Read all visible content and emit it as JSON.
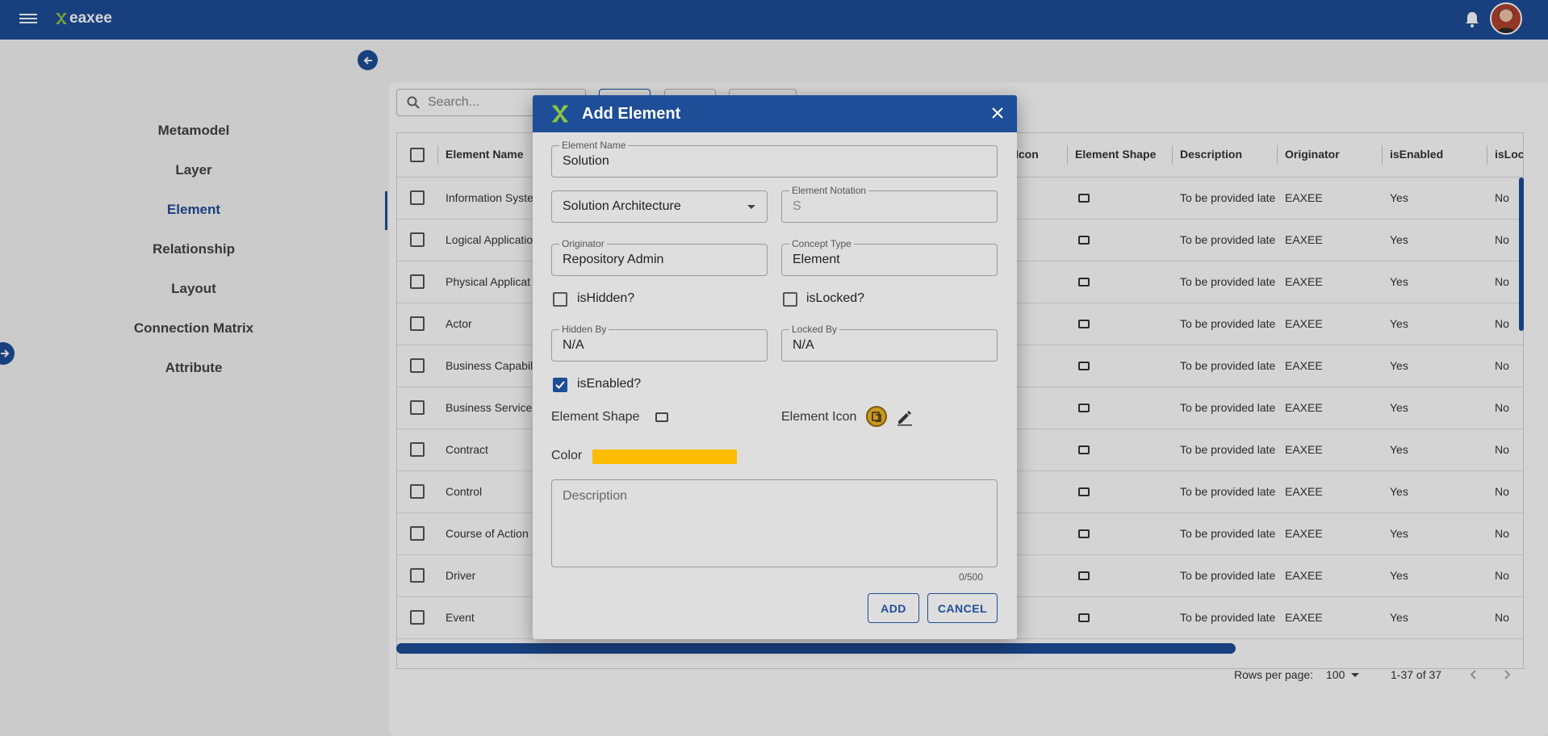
{
  "app": {
    "brand": "eaxee"
  },
  "search": {
    "placeholder": "Search..."
  },
  "sidebar": {
    "items": [
      {
        "label": "Metamodel"
      },
      {
        "label": "Layer"
      },
      {
        "label": "Element"
      },
      {
        "label": "Relationship"
      },
      {
        "label": "Layout"
      },
      {
        "label": "Connection Matrix"
      },
      {
        "label": "Attribute"
      }
    ],
    "active": "Element"
  },
  "table": {
    "columns": {
      "element_name": "Element Name",
      "icon": "Icon",
      "element_shape": "Element Shape",
      "description": "Description",
      "originator": "Originator",
      "is_enabled": "isEnabled",
      "is_locked": "isLoc"
    },
    "rows": [
      {
        "name": "Information Syste",
        "description": "To be provided late",
        "originator": "EAXEE",
        "enabled": "Yes",
        "locked": "No"
      },
      {
        "name": "Logical Applicatio",
        "description": "To be provided late",
        "originator": "EAXEE",
        "enabled": "Yes",
        "locked": "No"
      },
      {
        "name": "Physical Applicat",
        "description": "To be provided late",
        "originator": "EAXEE",
        "enabled": "Yes",
        "locked": "No"
      },
      {
        "name": "Actor",
        "description": "To be provided late",
        "originator": "EAXEE",
        "enabled": "Yes",
        "locked": "No"
      },
      {
        "name": "Business Capabil",
        "description": "To be provided late",
        "originator": "EAXEE",
        "enabled": "Yes",
        "locked": "No"
      },
      {
        "name": "Business Service",
        "description": "To be provided late",
        "originator": "EAXEE",
        "enabled": "Yes",
        "locked": "No"
      },
      {
        "name": "Contract",
        "description": "To be provided late",
        "originator": "EAXEE",
        "enabled": "Yes",
        "locked": "No"
      },
      {
        "name": "Control",
        "description": "To be provided late",
        "originator": "EAXEE",
        "enabled": "Yes",
        "locked": "No"
      },
      {
        "name": "Course of Action",
        "description": "To be provided late",
        "originator": "EAXEE",
        "enabled": "Yes",
        "locked": "No"
      },
      {
        "name": "Driver",
        "description": "To be provided late",
        "originator": "EAXEE",
        "enabled": "Yes",
        "locked": "No"
      },
      {
        "name": "Event",
        "description": "To be provided late",
        "originator": "EAXEE",
        "enabled": "Yes",
        "locked": "No"
      }
    ],
    "footer": {
      "rows_per_page_label": "Rows per page:",
      "rows_per_page_value": "100",
      "range": "1-37 of 37"
    }
  },
  "dialog": {
    "title": "Add Element",
    "element_name": {
      "label": "Element Name",
      "value": "Solution"
    },
    "layer_select": {
      "value": "Solution Architecture"
    },
    "element_notation": {
      "label": "Element Notation",
      "value": "S"
    },
    "originator": {
      "label": "Originator",
      "value": "Repository Admin"
    },
    "concept_type": {
      "label": "Concept Type",
      "value": "Element"
    },
    "is_hidden": {
      "label": "isHidden?",
      "checked": false
    },
    "is_locked": {
      "label": "isLocked?",
      "checked": false
    },
    "hidden_by": {
      "label": "Hidden By",
      "value": "N/A"
    },
    "locked_by": {
      "label": "Locked By",
      "value": "N/A"
    },
    "is_enabled": {
      "label": "isEnabled?",
      "checked": true
    },
    "element_shape_label": "Element Shape",
    "element_icon_label": "Element Icon",
    "color_label": "Color",
    "color_value": "#fcbd00",
    "description": {
      "placeholder": "Description",
      "counter": "0/500"
    },
    "add_label": "ADD",
    "cancel_label": "CANCEL"
  },
  "colors": {
    "primary": "#1e4e98",
    "brand_green": "#8cc63f"
  }
}
